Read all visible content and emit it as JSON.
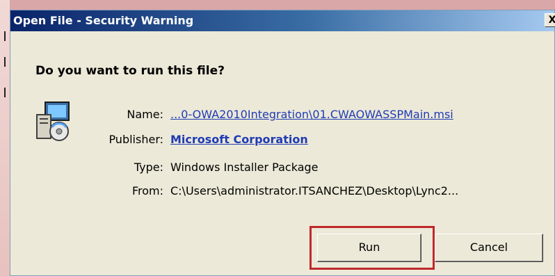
{
  "window": {
    "title": "Open File - Security Warning",
    "close_label": "X"
  },
  "prompt": {
    "question": "Do you want to run this file?"
  },
  "details": {
    "name_label": "Name:",
    "name_value": "...0-OWA2010Integration\\01.CWAOWASSPMain.msi",
    "publisher_label": "Publisher:",
    "publisher_value": "Microsoft Corporation",
    "type_label": "Type:",
    "type_value": "Windows Installer Package",
    "from_label": "From:",
    "from_value": "C:\\Users\\administrator.ITSANCHEZ\\Desktop\\Lync2..."
  },
  "buttons": {
    "run_label": "Run",
    "cancel_label": "Cancel"
  },
  "icon": {
    "semantic": "installer-package-icon"
  }
}
